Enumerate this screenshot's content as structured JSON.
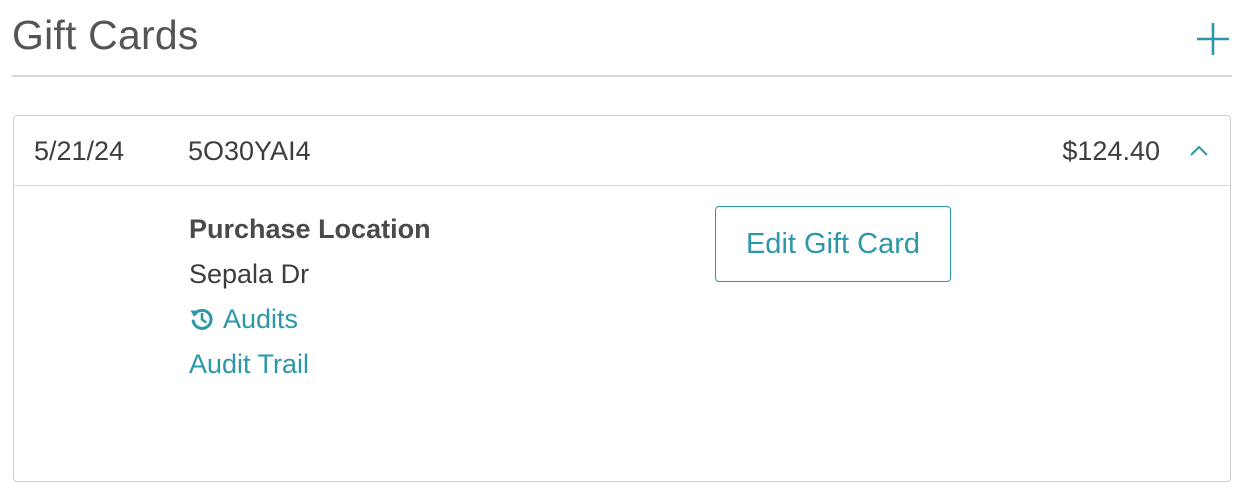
{
  "header": {
    "title": "Gift Cards",
    "add_icon": "plus-icon"
  },
  "gift_card": {
    "date": "5/21/24",
    "code": "5O30YAI4",
    "amount": "$124.40",
    "expanded": true,
    "toggle_icon": "chevron-up-icon",
    "details": {
      "purchase_location_label": "Purchase Location",
      "purchase_location_value": "Sepala Dr",
      "audits_icon": "history-icon",
      "audits_label": "Audits",
      "audit_trail_label": "Audit Trail",
      "edit_button_label": "Edit Gift Card"
    }
  },
  "colors": {
    "accent": "#2b97a8",
    "text": "#3d3d3d",
    "divider": "#d6d6d6"
  }
}
